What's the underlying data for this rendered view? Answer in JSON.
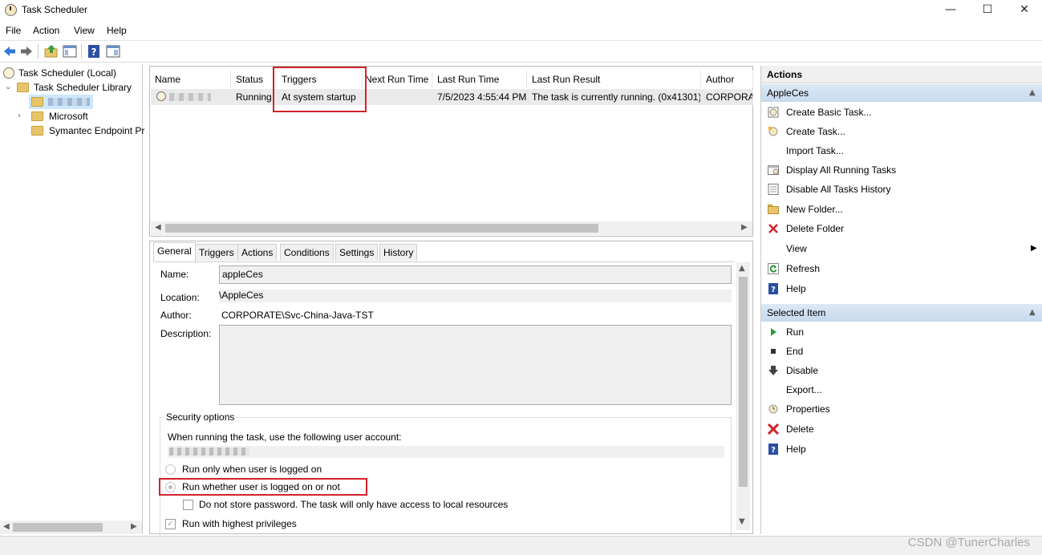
{
  "window": {
    "title": "Task Scheduler",
    "controls": [
      "—",
      "☐",
      "✕"
    ]
  },
  "menu": [
    "File",
    "Action",
    "View",
    "Help"
  ],
  "tree": {
    "root": "Task Scheduler (Local)",
    "library": "Task Scheduler Library",
    "children": [
      "Microsoft",
      "Symantec Endpoint Pr"
    ]
  },
  "task_list": {
    "columns": [
      "Name",
      "Status",
      "Triggers",
      "Next Run Time",
      "Last Run Time",
      "Last Run Result",
      "Author"
    ],
    "rows": [
      {
        "status": "Running",
        "triggers": "At system startup",
        "next_run_time": "",
        "last_run_time": "7/5/2023 4:55:44 PM",
        "last_run_result": "The task is currently running. (0x41301)",
        "author": "CORPORAT"
      }
    ]
  },
  "detail": {
    "tabs": [
      "General",
      "Triggers",
      "Actions",
      "Conditions",
      "Settings",
      "History"
    ],
    "active_tab": "General",
    "name_label": "Name:",
    "name_value": "appleCes",
    "location_label": "Location:",
    "location_value": "\\AppleCes",
    "author_label": "Author:",
    "author_value": "CORPORATE\\Svc-China-Java-TST",
    "description_label": "Description:",
    "description_value": "",
    "security_group": "Security options",
    "account_prompt": "When running the task, use the following user account:",
    "radio_logged_on": "Run only when user is logged on",
    "radio_whether": "Run whether user is logged on or not",
    "checkbox_no_store": "Do not store password.  The task will only have access to local resources",
    "checkbox_highest": "Run with highest privileges"
  },
  "actions_pane": {
    "header": "Actions",
    "section1": "AppleCes",
    "items1": [
      "Create Basic Task...",
      "Create Task...",
      "Import Task...",
      "Display All Running Tasks",
      "Disable All Tasks History",
      "New Folder...",
      "Delete Folder",
      "View",
      "Refresh",
      "Help"
    ],
    "section2": "Selected Item",
    "items2": [
      "Run",
      "End",
      "Disable",
      "Export...",
      "Properties",
      "Delete",
      "Help"
    ]
  },
  "watermark": "CSDN @TunerCharles",
  "colors": {
    "highlight_red": "#d2232a",
    "section_header_blue": "#c7daee"
  }
}
